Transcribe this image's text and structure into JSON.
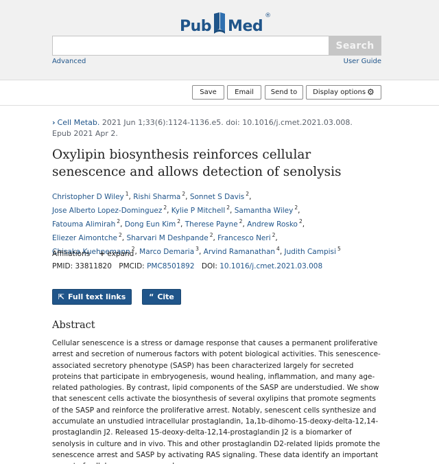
{
  "brand": {
    "logo_left": "Pub",
    "logo_right": "Med",
    "registered": "®"
  },
  "search": {
    "value": "",
    "placeholder": "",
    "button_label": "Search",
    "advanced": "Advanced",
    "user_guide": "User Guide"
  },
  "toolbar": {
    "save": "Save",
    "email": "Email",
    "send_to": "Send to",
    "display_options": "Display options"
  },
  "article": {
    "journal": "Cell Metab.",
    "citation": "2021 Jun 1;33(6):1124-1136.e5. doi: 10.1016/j.cmet.2021.03.008.",
    "epub": "Epub 2021 Apr 2.",
    "title": "Oxylipin biosynthesis reinforces cellular senescence and allows detection of senolysis",
    "authors": [
      {
        "name": "Christopher D Wiley",
        "aff": "1"
      },
      {
        "name": "Rishi Sharma",
        "aff": "2"
      },
      {
        "name": "Sonnet S Davis",
        "aff": "2"
      },
      {
        "name": "Jose Alberto Lopez-Dominguez",
        "aff": "2"
      },
      {
        "name": "Kylie P Mitchell",
        "aff": "2"
      },
      {
        "name": "Samantha Wiley",
        "aff": "2"
      },
      {
        "name": "Fatouma Alimirah",
        "aff": "2"
      },
      {
        "name": "Dong Eun Kim",
        "aff": "2"
      },
      {
        "name": "Therese Payne",
        "aff": "2"
      },
      {
        "name": "Andrew Rosko",
        "aff": "2"
      },
      {
        "name": "Eliezer Aimontche",
        "aff": "2"
      },
      {
        "name": "Sharvari M Deshpande",
        "aff": "2"
      },
      {
        "name": "Francesco Neri",
        "aff": "2"
      },
      {
        "name": "Chisaka Kuehnemann",
        "aff": "2"
      },
      {
        "name": "Marco Demaria",
        "aff": "3"
      },
      {
        "name": "Arvind Ramanathan",
        "aff": "4"
      },
      {
        "name": "Judith Campisi",
        "aff": "5"
      }
    ],
    "affiliations_label": "Affiliations",
    "expand_label": "expand",
    "pmid_label": "PMID:",
    "pmid": "33811820",
    "pmcid_label": "PMCID:",
    "pmcid": "PMC8501892",
    "doi_label": "DOI:",
    "doi": "10.1016/j.cmet.2021.03.008",
    "full_text_label": "Full text links",
    "cite_label": "Cite",
    "abstract_heading": "Abstract",
    "abstract": "Cellular senescence is a stress or damage response that causes a permanent proliferative arrest and secretion of numerous factors with potent biological activities. This senescence-associated secretory phenotype (SASP) has been characterized largely for secreted proteins that participate in embryogenesis, wound healing, inflammation, and many age-related pathologies. By contrast, lipid components of the SASP are understudied. We show that senescent cells activate the biosynthesis of several oxylipins that promote segments of the SASP and reinforce the proliferative arrest. Notably, senescent cells synthesize and accumulate an unstudied intracellular prostaglandin, 1a,1b-dihomo-15-deoxy-delta-12,14-prostaglandin J2. Released 15-deoxy-delta-12,14-prostaglandin J2 is a biomarker of senolysis in culture and in vivo. This and other prostaglandin D2-related lipids promote the senescence arrest and SASP by activating RAS signaling. These data identify an important aspect of cellular senescence and a"
  },
  "colors": {
    "link": "#20558a",
    "button": "#20558a",
    "masthead": "#f1f1f1"
  }
}
